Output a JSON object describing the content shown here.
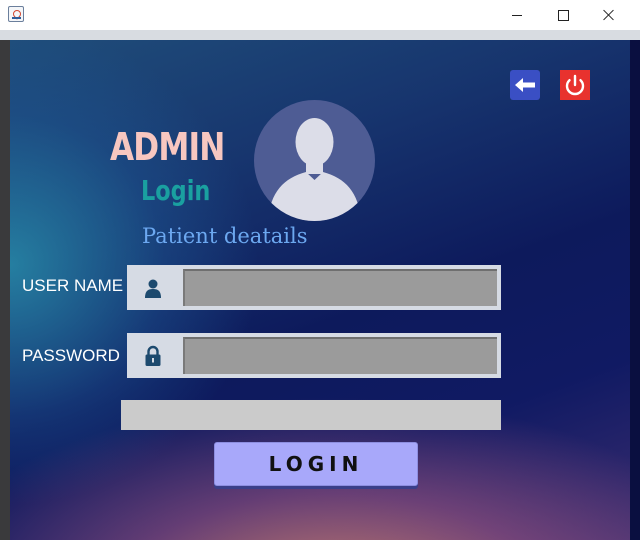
{
  "window": {
    "title": ""
  },
  "header": {
    "admin_title": "ADMIN",
    "login_subtitle": "Login",
    "patient_text": "Patient deatails"
  },
  "form": {
    "username_label": "USER NAME",
    "password_label": "PASSWORD",
    "username_value": "",
    "password_value": "",
    "message": "",
    "login_label": "LOGIN"
  },
  "icons": {
    "app": "java-cup-icon",
    "back": "arrow-left-icon",
    "power": "power-icon",
    "avatar": "user-silhouette-icon",
    "user_field": "user-icon",
    "password_field": "lock-icon"
  },
  "colors": {
    "admin_title": "#f7c7c0",
    "login_subtitle": "#1aa0a0",
    "patient_text": "#6ca8f0",
    "back_button": "#3a4fc4",
    "power_button": "#e8322e",
    "login_button": "#a8a8fa"
  }
}
